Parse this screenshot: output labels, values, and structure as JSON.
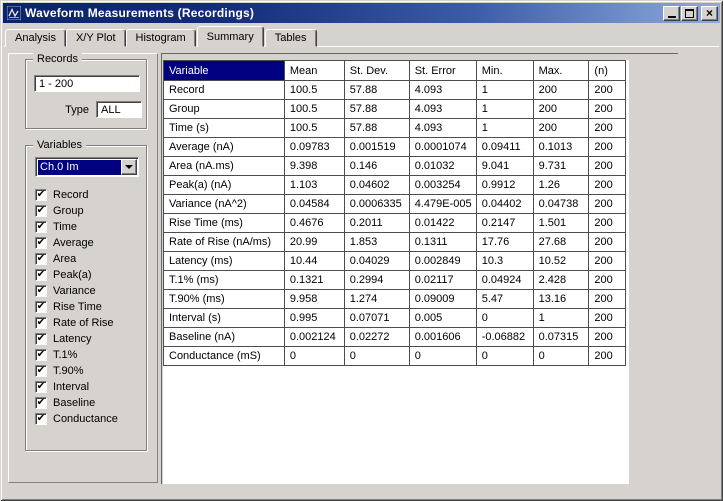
{
  "window": {
    "title": "Waveform Measurements (Recordings)",
    "controls": {
      "minimize": "minimize",
      "maximize": "maximize",
      "close": "close"
    }
  },
  "tabs": [
    {
      "label": "Analysis",
      "active": false
    },
    {
      "label": "X/Y Plot",
      "active": false
    },
    {
      "label": "Histogram",
      "active": false
    },
    {
      "label": "Summary",
      "active": true
    },
    {
      "label": "Tables",
      "active": false
    }
  ],
  "records": {
    "label": "Records",
    "range": "1 - 200",
    "type_label": "Type",
    "type_value": "ALL"
  },
  "variables": {
    "label": "Variables",
    "channel": "Ch.0 Im",
    "checkboxes": [
      {
        "label": "Record",
        "checked": true
      },
      {
        "label": "Group",
        "checked": true
      },
      {
        "label": "Time",
        "checked": true
      },
      {
        "label": "Average",
        "checked": true
      },
      {
        "label": "Area",
        "checked": true
      },
      {
        "label": "Peak(a)",
        "checked": true
      },
      {
        "label": "Variance",
        "checked": true
      },
      {
        "label": "Rise Time",
        "checked": true
      },
      {
        "label": "Rate of Rise",
        "checked": true
      },
      {
        "label": "Latency",
        "checked": true
      },
      {
        "label": "T.1%",
        "checked": true
      },
      {
        "label": "T.90%",
        "checked": true
      },
      {
        "label": "Interval",
        "checked": true
      },
      {
        "label": "Baseline",
        "checked": true
      },
      {
        "label": "Conductance",
        "checked": true
      }
    ]
  },
  "table": {
    "columns": [
      "Variable",
      "Mean",
      "St. Dev.",
      "St. Error",
      "Min.",
      "Max.",
      "(n)"
    ],
    "rows": [
      {
        "variable": "Record",
        "values": [
          "100.5",
          "57.88",
          "4.093",
          "1",
          "200",
          "200"
        ]
      },
      {
        "variable": "Group",
        "values": [
          "100.5",
          "57.88",
          "4.093",
          "1",
          "200",
          "200"
        ]
      },
      {
        "variable": "Time (s)",
        "values": [
          "100.5",
          "57.88",
          "4.093",
          "1",
          "200",
          "200"
        ]
      },
      {
        "variable": "Average (nA)",
        "values": [
          "0.09783",
          "0.001519",
          "0.0001074",
          "0.09411",
          "0.1013",
          "200"
        ]
      },
      {
        "variable": "Area (nA.ms)",
        "values": [
          "9.398",
          "0.146",
          "0.01032",
          "9.041",
          "9.731",
          "200"
        ]
      },
      {
        "variable": "Peak(a) (nA)",
        "values": [
          "1.103",
          "0.04602",
          "0.003254",
          "0.9912",
          "1.26",
          "200"
        ]
      },
      {
        "variable": "Variance (nA^2)",
        "values": [
          "0.04584",
          "0.0006335",
          "4.479E-005",
          "0.04402",
          "0.04738",
          "200"
        ]
      },
      {
        "variable": "Rise Time (ms)",
        "values": [
          "0.4676",
          "0.2011",
          "0.01422",
          "0.2147",
          "1.501",
          "200"
        ]
      },
      {
        "variable": "Rate of Rise (nA/ms)",
        "values": [
          "20.99",
          "1.853",
          "0.1311",
          "17.76",
          "27.68",
          "200"
        ]
      },
      {
        "variable": "Latency (ms)",
        "values": [
          "10.44",
          "0.04029",
          "0.002849",
          "10.3",
          "10.52",
          "200"
        ]
      },
      {
        "variable": "T.1% (ms)",
        "values": [
          "0.1321",
          "0.2994",
          "0.02117",
          "0.04924",
          "2.428",
          "200"
        ]
      },
      {
        "variable": "T.90% (ms)",
        "values": [
          "9.958",
          "1.274",
          "0.09009",
          "5.47",
          "13.16",
          "200"
        ]
      },
      {
        "variable": "Interval (s)",
        "values": [
          "0.995",
          "0.07071",
          "0.005",
          "0",
          "1",
          "200"
        ]
      },
      {
        "variable": "Baseline (nA)",
        "values": [
          "0.002124",
          "0.02272",
          "0.001606",
          "-0.06882",
          "0.07315",
          "200"
        ]
      },
      {
        "variable": "Conductance (mS)",
        "values": [
          "0",
          "0",
          "0",
          "0",
          "0",
          "200"
        ]
      }
    ]
  },
  "colors": {
    "face": "#d6d3ce",
    "titlebar_left": "#0a246a",
    "titlebar_right": "#8fabdc",
    "header_selected_bg": "#000080",
    "selection_bg": "#000080",
    "table_grid": "#4d4d4d"
  },
  "icons": {
    "check": "✔",
    "close": "×"
  }
}
